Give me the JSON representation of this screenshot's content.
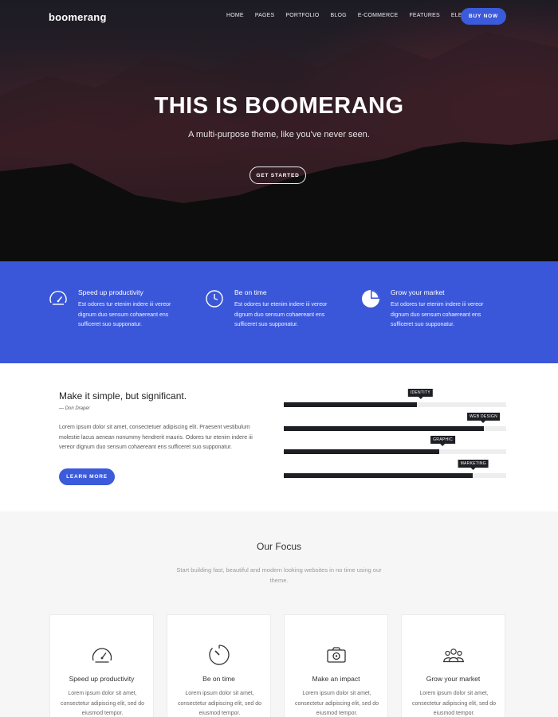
{
  "brand": {
    "logo": "boomerang",
    "accent": "#3b5bdb",
    "band_color": "#3b57d9"
  },
  "nav": {
    "items": [
      "HOME",
      "PAGES",
      "PORTFOLIO",
      "BLOG",
      "E-COMMERCE",
      "FEATURES",
      "ELEMENTS"
    ],
    "cta": "BUY NOW"
  },
  "hero": {
    "title_prefix": "THIS IS ",
    "title_bold": "BOOMERANG",
    "subtitle": "A multi-purpose theme, like you've never seen.",
    "button": "GET STARTED"
  },
  "features": [
    {
      "icon": "speedometer-icon",
      "title": "Speed up productivity",
      "text": "Est odores tur etenim indere iii vereor dignum duo sensum cohaereant ens sufficeret suo supponatur."
    },
    {
      "icon": "clock-icon",
      "title": "Be on time",
      "text": "Est odores tur etenim indere iii vereor dignum duo sensum cohaereant ens sufficeret suo supponatur."
    },
    {
      "icon": "pie-chart-icon",
      "title": "Grow your market",
      "text": "Est odores tur etenim indere iii vereor dignum duo sensum cohaereant ens sufficeret suo supponatur."
    }
  ],
  "skills": {
    "heading": "Make it simple, but significant.",
    "author": "— Don Draper",
    "text": "Lorem ipsum dolor sit amet, consectetuer adipiscing elit. Praesent vestibulum molestie lacus aenean nonummy hendrerit mauris. Odores tur etenim indere iii vereor dignum duo sensum cohaereant ens sufficeret suo supponatur.",
    "button": "LEARN MORE",
    "bars": [
      {
        "label": "IDENTITY",
        "level": 0.6
      },
      {
        "label": "WEB DESIGN",
        "level": 0.9
      },
      {
        "label": "GRAPHIC",
        "level": 0.7
      },
      {
        "label": "MARKETING",
        "level": 0.85
      }
    ]
  },
  "focus": {
    "heading": "Our Focus",
    "lead": "Start building fast, beautiful and modern looking websites in no time using our theme.",
    "cards": [
      {
        "icon": "speedometer-icon",
        "title": "Speed up productivity",
        "text": "Lorem ipsum dolor sit amet, consectetur adipiscing elit, sed do eiusmod tempor."
      },
      {
        "icon": "timer-icon",
        "title": "Be on time",
        "text": "Lorem ipsum dolor sit amet, consectetur adipiscing elit, sed do eiusmod tempor."
      },
      {
        "icon": "camera-icon",
        "title": "Make an impact",
        "text": "Lorem ipsum dolor sit amet, consectetur adipiscing elit, sed do eiusmod tempor."
      },
      {
        "icon": "team-icon",
        "title": "Grow your market",
        "text": "Lorem ipsum dolor sit amet, consectetur adipiscing elit, sed do eiusmod tempor."
      }
    ]
  }
}
